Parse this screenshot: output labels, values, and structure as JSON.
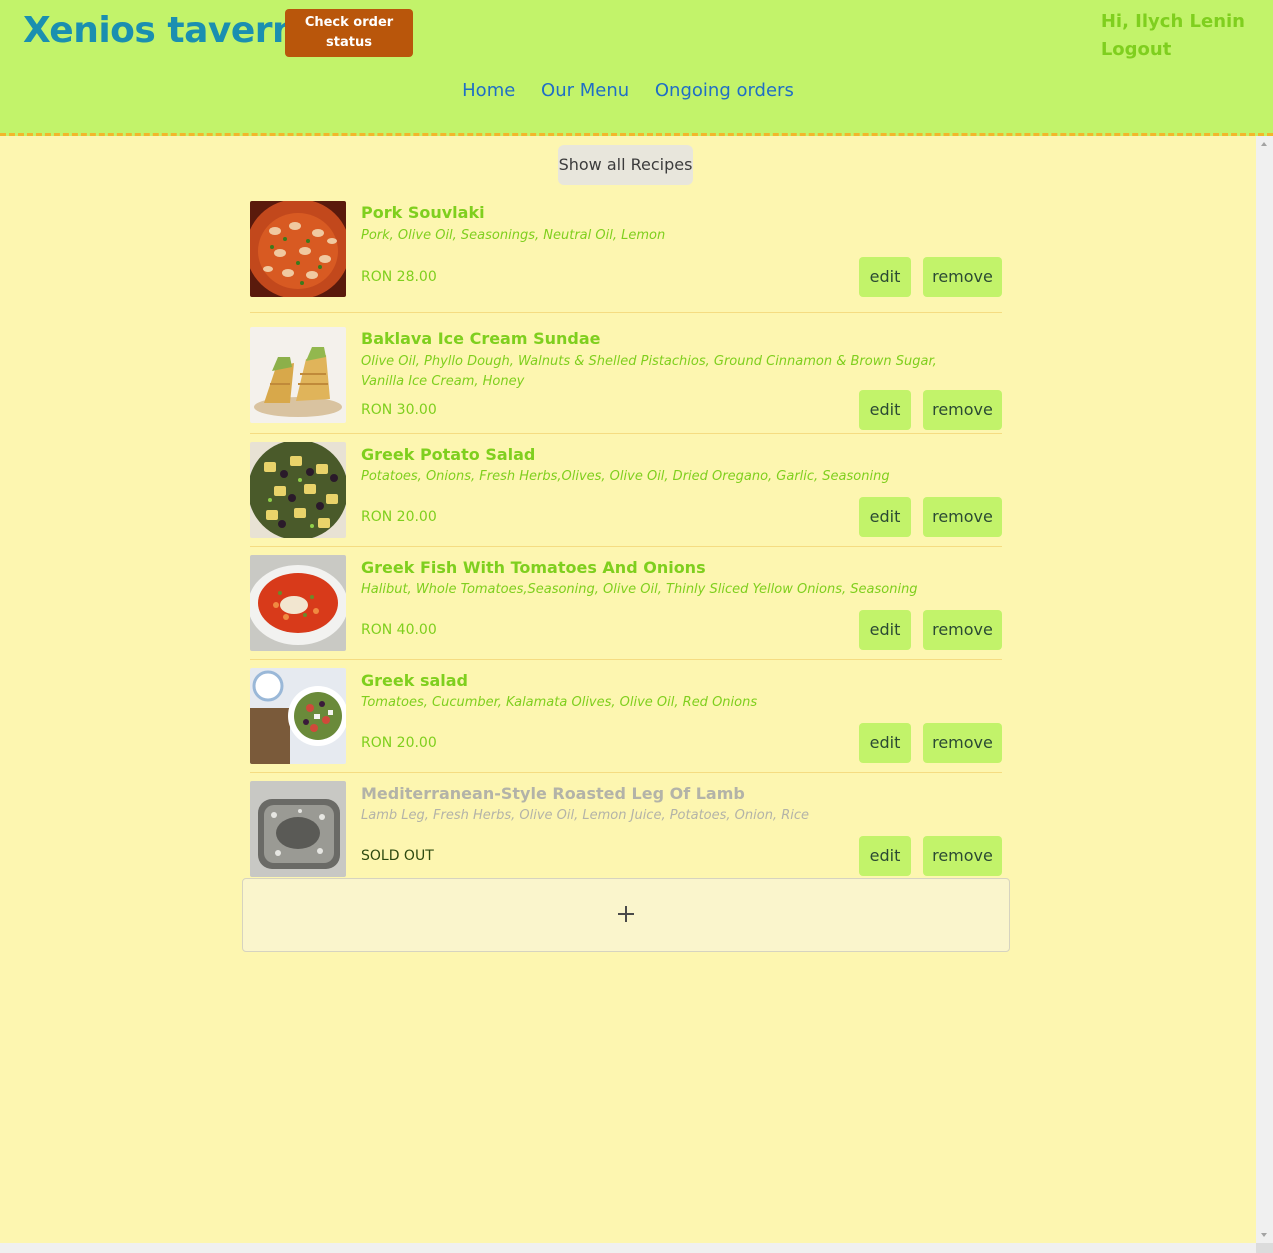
{
  "header": {
    "brand": "Xenios taverna",
    "check_order_button": "Check order status",
    "greeting": "Hi, Ilych Lenin",
    "logout": "Logout"
  },
  "nav": {
    "home": "Home",
    "menu": "Our Menu",
    "orders": "Ongoing orders"
  },
  "show_all_button": "Show all Recipes",
  "recipes": [
    {
      "title": "Pork Souvlaki",
      "ingredients": "Pork, Olive Oil, Seasonings, Neutral Oil, Lemon",
      "price": "RON 28.00",
      "edit": "edit",
      "remove": "remove",
      "image": "shrimp-dish-thumbnail"
    },
    {
      "title": "Baklava Ice Cream Sundae",
      "ingredients": "Olive Oil, Phyllo Dough, Walnuts & Shelled Pistachios, Ground Cinnamon & Brown Sugar, Vanilla Ice Cream, Honey",
      "price": "RON 30.00",
      "edit": "edit",
      "remove": "remove",
      "image": "baklava-thumbnail"
    },
    {
      "title": "Greek Potato Salad",
      "ingredients": "Potatoes, Onions, Fresh Herbs,Olives, Olive Oil, Dried Oregano, Garlic, Seasoning",
      "price": "RON 20.00",
      "edit": "edit",
      "remove": "remove",
      "image": "potato-salad-thumbnail"
    },
    {
      "title": "Greek Fish With Tomatoes And Onions",
      "ingredients": "Halibut, Whole Tomatoes,Seasoning, Olive Oil, Thinly Sliced Yellow Onions, Seasoning",
      "price": "RON 40.00",
      "edit": "edit",
      "remove": "remove",
      "image": "fish-stew-thumbnail"
    },
    {
      "title": "Greek salad",
      "ingredients": "Tomatoes, Cucumber, Kalamata Olives, Olive Oil, Red Onions",
      "price": "RON 20.00",
      "edit": "edit",
      "remove": "remove",
      "image": "greek-salad-thumbnail"
    },
    {
      "title": "Mediterranean-Style Roasted Leg Of Lamb",
      "ingredients": "Lamb Leg, Fresh Herbs, Olive Oil, Lemon Juice, Potatoes, Onion, Rice",
      "price": "SOLD OUT",
      "edit": "edit",
      "remove": "remove",
      "image": "roasted-lamb-thumbnail"
    }
  ],
  "add_icon": "plus-icon",
  "colors": {
    "header_bg": "#c2f36a",
    "page_bg": "#fdf6b0",
    "brand": "#1a8fb0",
    "accent_green": "#7fcf1e",
    "order_button": "#b9560b",
    "nav_link": "#1f6ec6"
  }
}
